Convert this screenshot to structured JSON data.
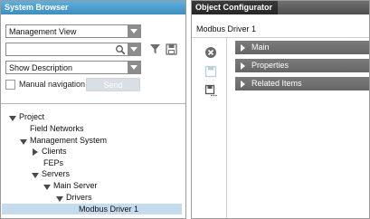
{
  "system_browser": {
    "title": "System Browser",
    "view_select": "Management View",
    "search_value": "",
    "description_select": "Show Description",
    "manual_navigation_label": "Manual navigation",
    "send_label": "Send",
    "tree": [
      {
        "label": "Project"
      },
      {
        "label": "Field Networks"
      },
      {
        "label": "Management System"
      },
      {
        "label": "Clients"
      },
      {
        "label": "FEPs"
      },
      {
        "label": "Servers"
      },
      {
        "label": "Main Server"
      },
      {
        "label": "Drivers"
      },
      {
        "label": "Modbus Driver 1"
      }
    ]
  },
  "object_configurator": {
    "title": "Object Configurator",
    "object_name": "Modbus Driver 1",
    "sections": [
      {
        "label": "Main"
      },
      {
        "label": "Properties"
      },
      {
        "label": "Related Items"
      }
    ]
  },
  "colors": {
    "system_browser_header": "#3d8ec0",
    "object_configurator_header": "#262626",
    "section_bar": "#6e6e6e",
    "selection": "#c5dcee"
  }
}
